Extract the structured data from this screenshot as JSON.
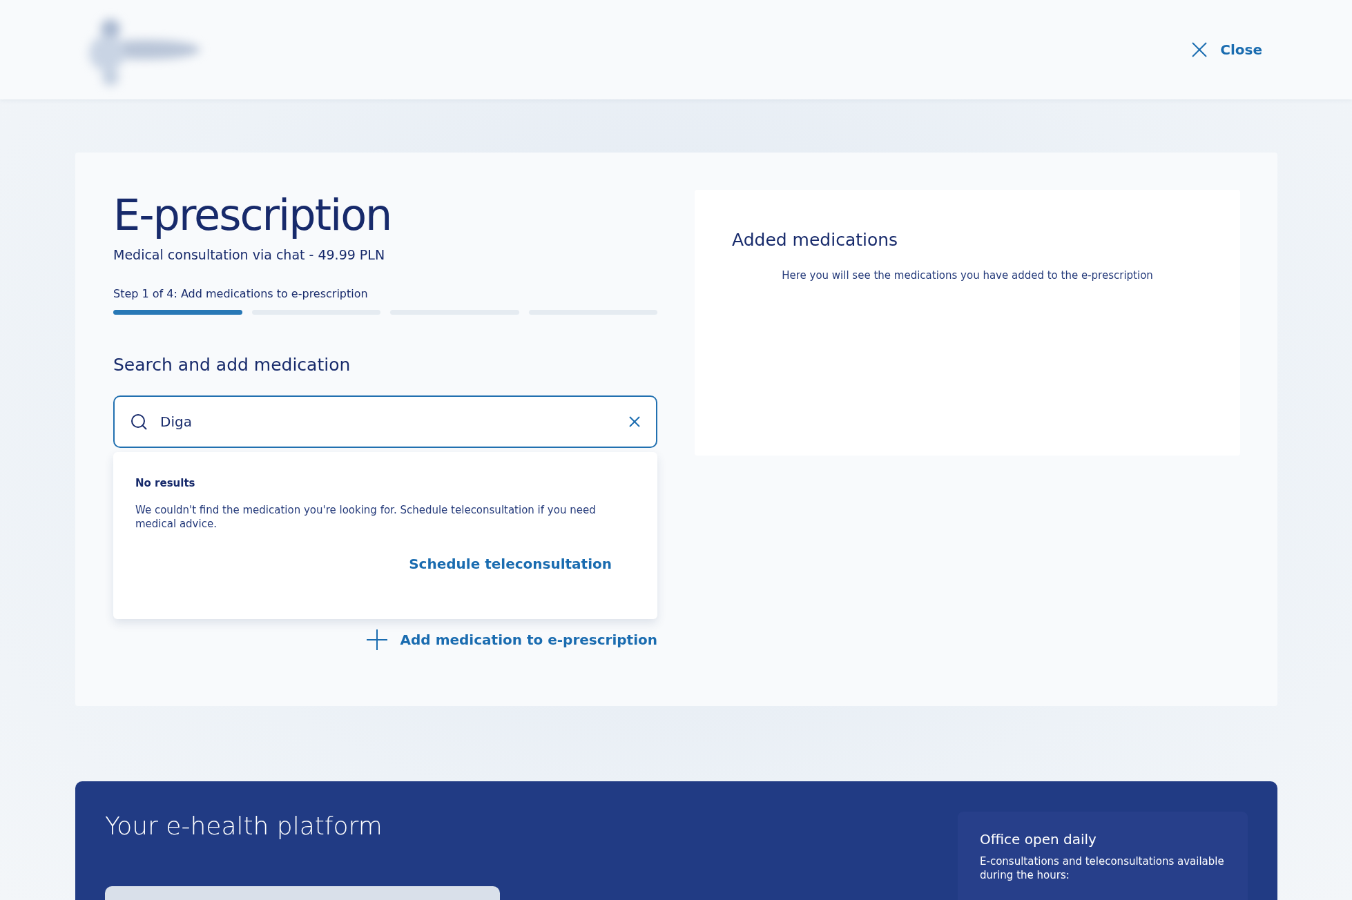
{
  "header": {
    "close_label": "Close"
  },
  "form": {
    "title": "E-prescription",
    "subtitle": "Medical consultation via chat - ",
    "price": "49.99 PLN",
    "step_label": "Step 1 of 4: Add medications to e-prescription",
    "steps": [
      {
        "active": true
      },
      {
        "active": false
      },
      {
        "active": false
      },
      {
        "active": false
      }
    ],
    "section_title": "Search and add medication",
    "search": {
      "value": "Diga"
    },
    "dropdown": {
      "title": "No results",
      "message": "We couldn't find the medication you're looking for. Schedule teleconsultation if you need medical advice.",
      "link": "Schedule teleconsultation"
    },
    "add_button": "Add medication to e-prescription"
  },
  "added_panel": {
    "title": "Added medications",
    "empty_message": "Here you will see the medications you have added to the e-prescription"
  },
  "footer": {
    "title": "Your e-health platform",
    "office": {
      "title": "Office open daily",
      "text": "E-consultations and teleconsultations available during the hours:"
    }
  }
}
